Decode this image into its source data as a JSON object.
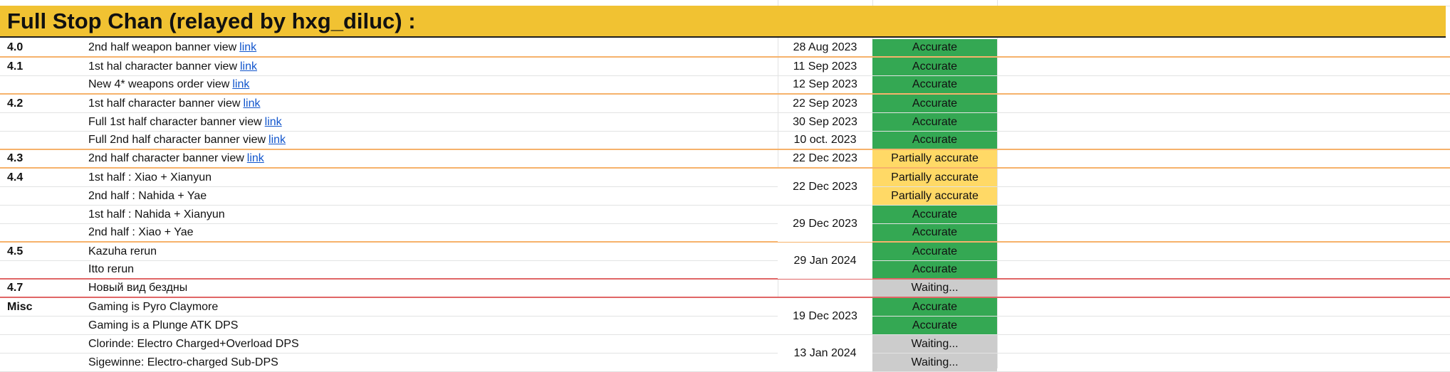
{
  "header": {
    "title": "Full Stop Chan (relayed by hxg_diluc) :"
  },
  "rows": [
    {
      "version": "4.0",
      "desc": "2nd half weapon banner view",
      "link": "link",
      "date": "28 Aug 2023",
      "status": "Accurate"
    },
    {
      "version": "4.1",
      "desc": "1st hal character banner view",
      "link": "link",
      "date": "11 Sep 2023",
      "status": "Accurate"
    },
    {
      "version": "",
      "desc": "New 4* weapons order view",
      "link": "link",
      "date": "12 Sep 2023",
      "status": "Accurate"
    },
    {
      "version": "4.2",
      "desc": "1st half character banner view",
      "link": "link",
      "date": "22 Sep 2023",
      "status": "Accurate"
    },
    {
      "version": "",
      "desc": "Full 1st half character banner view",
      "link": "link",
      "date": "30 Sep 2023",
      "status": "Accurate"
    },
    {
      "version": "",
      "desc": "Full 2nd half character banner view",
      "link": "link",
      "date": "10 oct. 2023",
      "status": "Accurate"
    },
    {
      "version": "4.3",
      "desc": "2nd half character banner view",
      "link": "link",
      "date": "22 Dec 2023",
      "status": "Partially accurate"
    },
    {
      "version": "4.4",
      "desc": "1st half : Xiao + Xianyun",
      "link": "",
      "date": "",
      "status": "Partially accurate"
    },
    {
      "version": "",
      "desc": "2nd half : Nahida + Yae",
      "link": "",
      "date": "",
      "status": "Partially accurate"
    },
    {
      "version": "",
      "desc": "1st half : Nahida + Xianyun",
      "link": "",
      "date": "",
      "status": "Accurate"
    },
    {
      "version": "",
      "desc": "2nd half : Xiao + Yae",
      "link": "",
      "date": "",
      "status": "Accurate"
    },
    {
      "version": "4.5",
      "desc": "Kazuha rerun",
      "link": "",
      "date": "",
      "status": "Accurate"
    },
    {
      "version": "",
      "desc": "Itto rerun",
      "link": "",
      "date": "",
      "status": "Accurate"
    },
    {
      "version": "4.7",
      "desc": "Новый вид бездны",
      "link": "",
      "date": "",
      "status": "Waiting..."
    },
    {
      "version": "Misc",
      "desc": "Gaming is Pyro Claymore",
      "link": "",
      "date": "",
      "status": "Accurate"
    },
    {
      "version": "",
      "desc": "Gaming is a Plunge ATK DPS",
      "link": "",
      "date": "",
      "status": "Accurate"
    },
    {
      "version": "",
      "desc": "Clorinde: Electro Charged+Overload DPS",
      "link": "",
      "date": "",
      "status": "Waiting..."
    },
    {
      "version": "",
      "desc": "Sigewinne: Electro-charged Sub-DPS",
      "link": "",
      "date": "",
      "status": "Waiting..."
    }
  ],
  "merged_dates": [
    {
      "rows": [
        7,
        8
      ],
      "date": "22 Dec 2023"
    },
    {
      "rows": [
        9,
        10
      ],
      "date": "29 Dec 2023"
    },
    {
      "rows": [
        11,
        12
      ],
      "date": "29 Jan 2024"
    },
    {
      "rows": [
        14,
        15
      ],
      "date": "19 Dec 2023"
    },
    {
      "rows": [
        16,
        17
      ],
      "date": "13 Jan 2024"
    }
  ],
  "status_colors": {
    "Accurate": "#34a853",
    "Partially accurate": "#ffd966",
    "Waiting...": "#cccccc"
  },
  "separator_colors": {
    "orange": "#f6b26b",
    "red": "#e06666"
  }
}
